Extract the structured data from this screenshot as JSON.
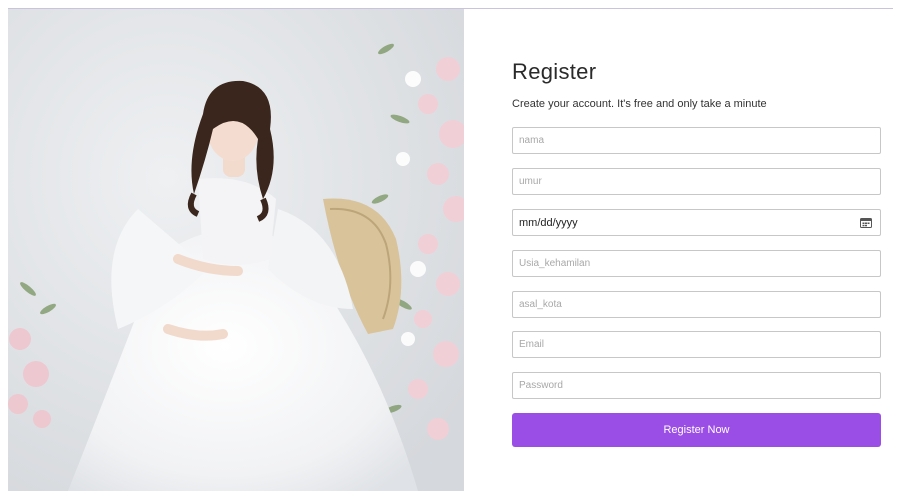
{
  "photo": {
    "alt": "Pregnant woman in white tulle dress seated on a rattan chair with pink flowers"
  },
  "form": {
    "title": "Register",
    "subtitle": "Create your account. It's free and only take a minute",
    "fields": {
      "nama": {
        "placeholder": "nama"
      },
      "umur": {
        "placeholder": "umur"
      },
      "tanggal": {
        "value": "mm/dd/yyyy"
      },
      "usia_kehamilan": {
        "placeholder": "Usia_kehamilan"
      },
      "asal_kota": {
        "placeholder": "asal_kota"
      },
      "email": {
        "placeholder": "Email"
      },
      "password": {
        "placeholder": "Password"
      }
    },
    "submit_label": "Register Now"
  },
  "colors": {
    "accent": "#9b4ee6",
    "field_border": "#c7c7c7",
    "text": "#2a2a2a"
  },
  "icons": {
    "date_picker": "calendar-icon"
  }
}
